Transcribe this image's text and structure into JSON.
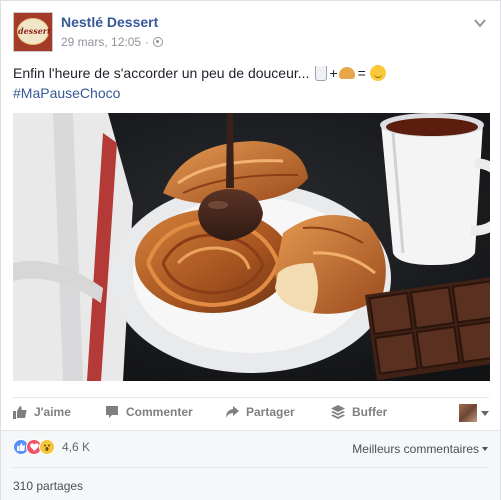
{
  "post": {
    "page_name": "Nestlé Dessert",
    "avatar_text": "dessert",
    "date": "29 mars, 12:05",
    "separator": "·",
    "caption_text": "Enfin l'heure de s'accorder un peu de douceur...",
    "caption_plus": "+",
    "caption_equals": "=",
    "hashtag": "#MaPauseChoco",
    "emojis": [
      "glass-of-milk-icon",
      "croissant-icon",
      "smiling-face-icon"
    ],
    "photo_alt_icons": [
      "croissant",
      "chocolate-drizzle",
      "cup-of-coffee",
      "chocolate-bar"
    ]
  },
  "actions": {
    "like": "J'aime",
    "comment": "Commenter",
    "share": "Partager",
    "buffer": "Buffer"
  },
  "reactions": {
    "count": "4,6 K",
    "types": [
      "like-icon",
      "love-icon",
      "wow-icon"
    ],
    "sort_label": "Meilleurs commentaires",
    "shares": "310 partages"
  },
  "colors": {
    "link": "#365899",
    "meta": "#90949c",
    "action": "#7f7f7f",
    "like": "#5890ff",
    "love": "#f25268",
    "wow": "#f7c43d",
    "footer_bg": "#f6f7f9"
  }
}
